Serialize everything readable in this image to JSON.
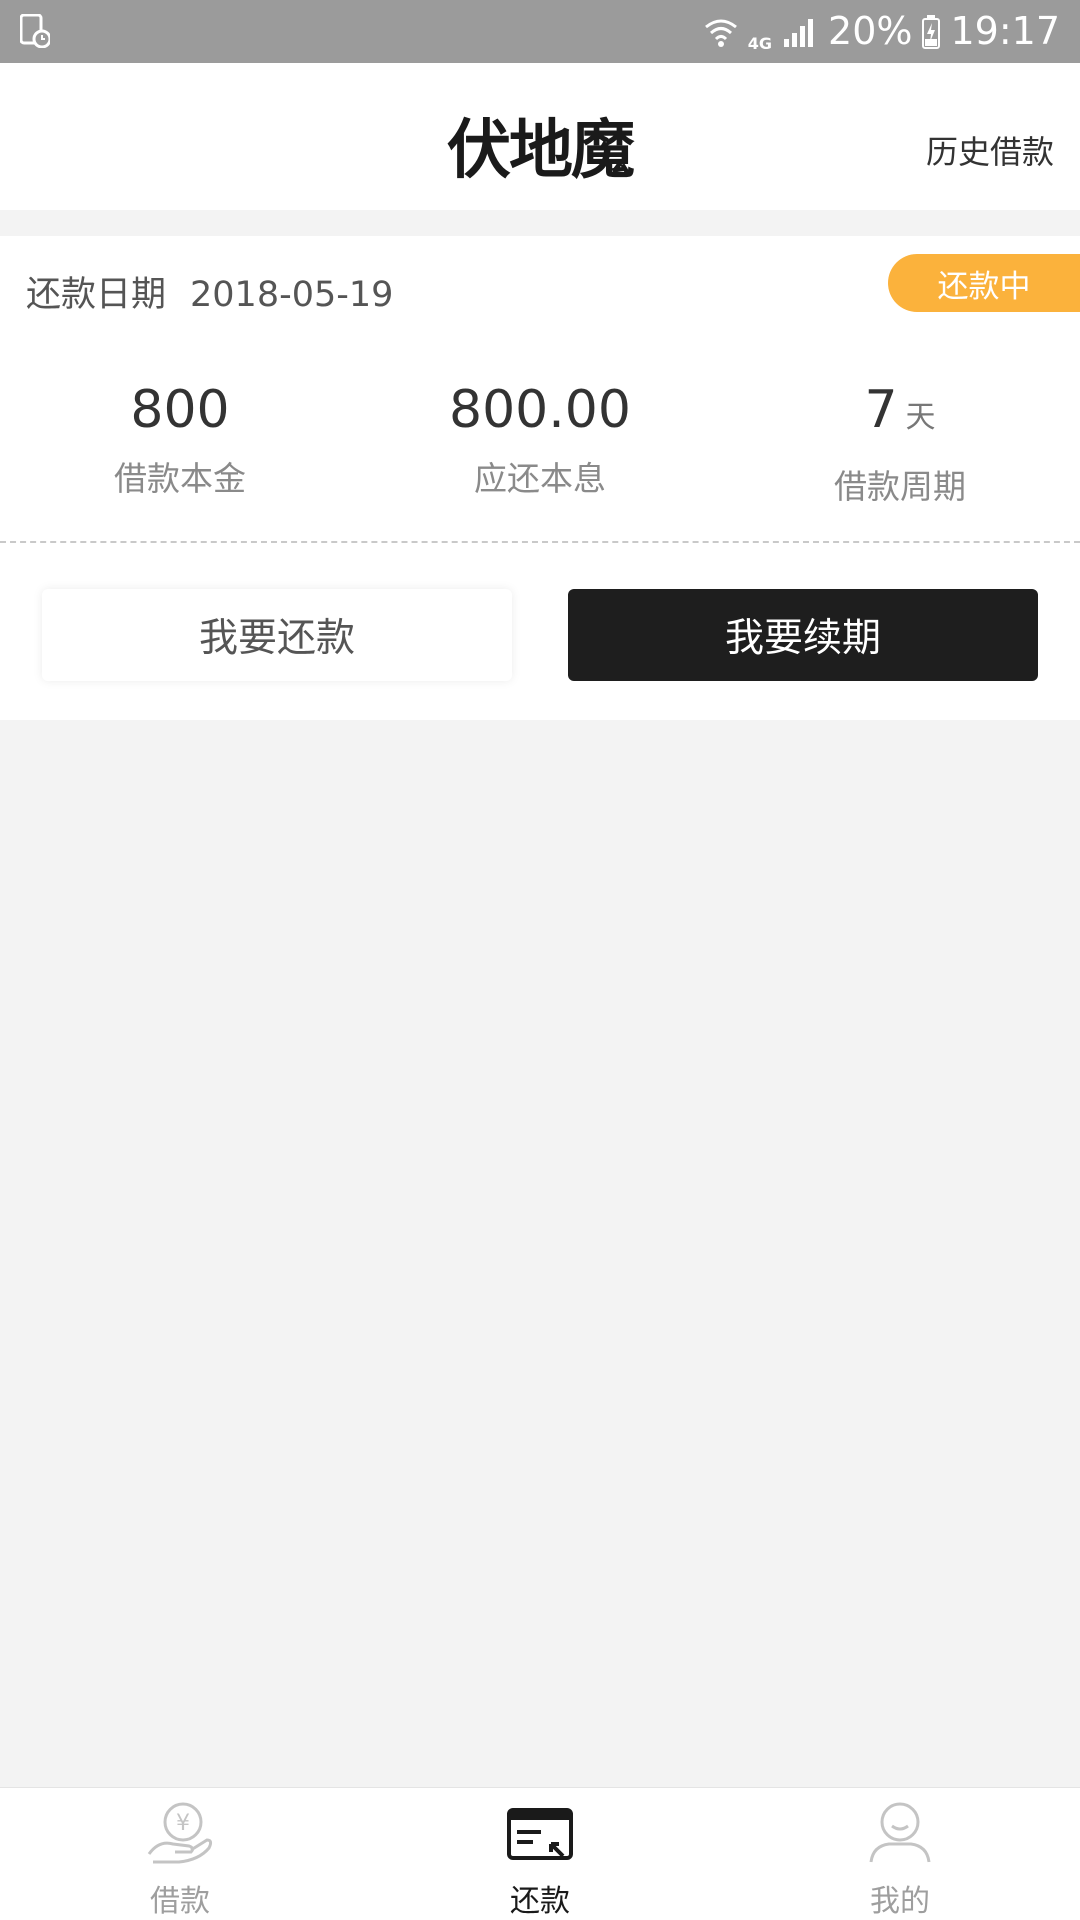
{
  "status_bar": {
    "network": "4G",
    "battery": "20%",
    "time": "19:17"
  },
  "header": {
    "logo": "伏地魔",
    "history_link": "历史借款"
  },
  "loan_card": {
    "date_label": "还款日期",
    "date_value": "2018-05-19",
    "status_badge": "还款中",
    "stats": [
      {
        "value": "800",
        "unit": "",
        "label": "借款本金"
      },
      {
        "value": "800.00",
        "unit": "",
        "label": "应还本息"
      },
      {
        "value": "7",
        "unit": "天",
        "label": "借款周期"
      }
    ],
    "repay_button": "我要还款",
    "renew_button": "我要续期"
  },
  "bottom_nav": {
    "items": [
      {
        "label": "借款",
        "icon": "hand-yuan-icon",
        "active": false
      },
      {
        "label": "还款",
        "icon": "card-repay-icon",
        "active": true
      },
      {
        "label": "我的",
        "icon": "user-icon",
        "active": false
      }
    ]
  },
  "colors": {
    "status_badge": "#fbb23c",
    "primary_button": "#1e1e1e",
    "background": "#f3f3f3"
  }
}
